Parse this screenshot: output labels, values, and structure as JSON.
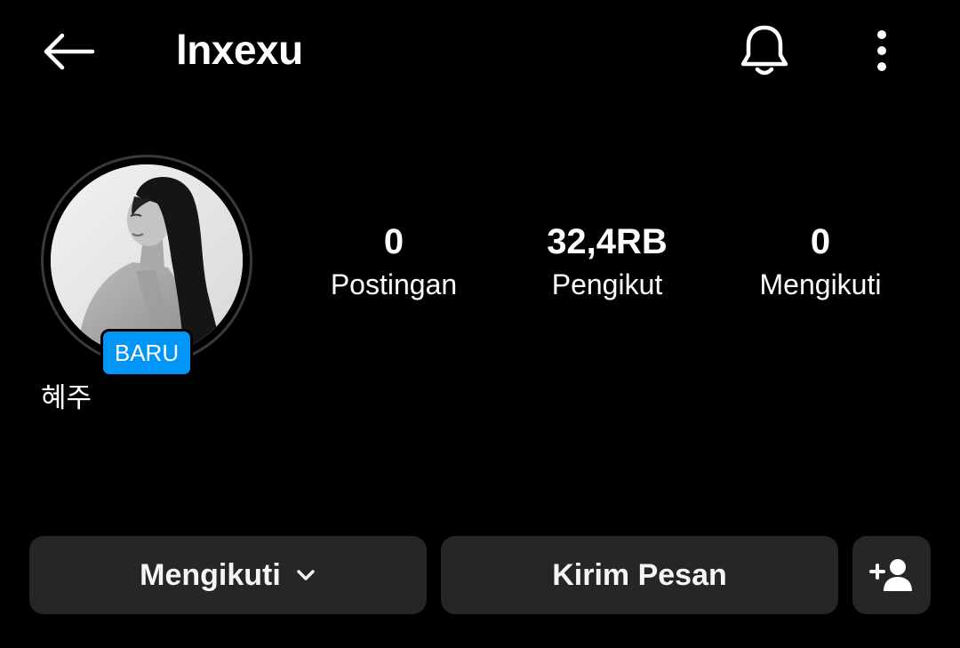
{
  "header": {
    "username": "lnxexu",
    "back_icon": "arrow-left-icon",
    "bell_icon": "bell-icon",
    "more_icon": "more-vertical-icon"
  },
  "profile": {
    "badge": "BARU",
    "display_name": "혜주",
    "avatar": "profile-photo"
  },
  "stats": [
    {
      "value": "0",
      "label": "Postingan"
    },
    {
      "value": "32,4RB",
      "label": "Pengikut"
    },
    {
      "value": "0",
      "label": "Mengikuti"
    }
  ],
  "actions": {
    "following_label": "Mengikuti",
    "message_label": "Kirim Pesan",
    "add_friend_icon": "person-add-icon"
  },
  "colors": {
    "background": "#000000",
    "button": "#262626",
    "badge": "#0095f6",
    "text": "#ffffff"
  }
}
